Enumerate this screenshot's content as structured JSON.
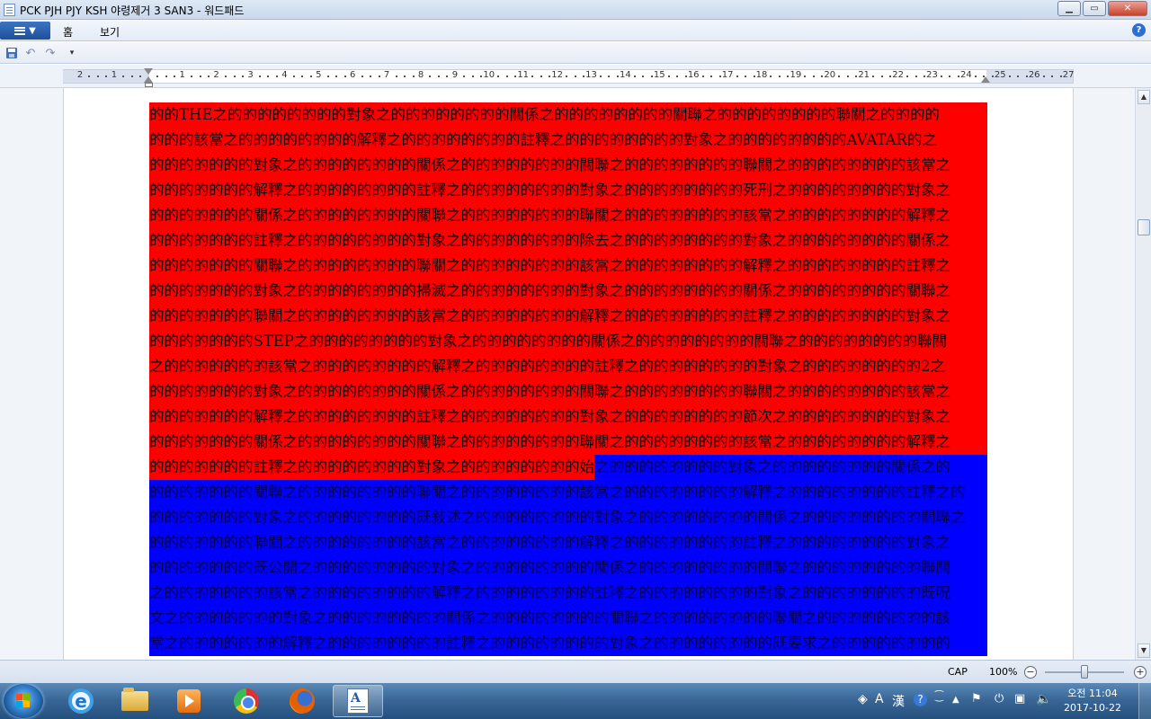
{
  "window": {
    "title": "PCK PJH PJY KSH 야령제거 3 SAN3 - 워드패드",
    "min_glyph": "▁",
    "max_glyph": "▭",
    "close_glyph": "✕"
  },
  "ribbon": {
    "tabs": [
      "홈",
      "보기"
    ],
    "help_glyph": "?"
  },
  "quick_access": {
    "undo_glyph": "↶",
    "redo_glyph": "↷",
    "dropdown_glyph": "▾"
  },
  "ruler": {
    "labels": [
      "2",
      "1",
      "",
      "1",
      "2",
      "3",
      "4",
      "5",
      "6",
      "7",
      "8",
      "9",
      "10",
      "11",
      "12",
      "13",
      "14",
      "15",
      "16",
      "17",
      "18",
      "19",
      "20",
      "21",
      "22",
      "23",
      "24",
      "25",
      "26",
      "27"
    ]
  },
  "document": {
    "lines": [
      [
        {
          "t": "的的THE之的的的的的的的的對象之的的的的的的的的關係之的的的的的的的的關聯之的的的的的的的的聯關之的的的的",
          "c": "red"
        }
      ],
      [
        {
          "t": "的的的該當之的的的的的的的的解釋之的的的的的的的的註釋之的的的的的的的的對象之的的的的的的的的AVATAR的之",
          "c": "red"
        }
      ],
      [
        {
          "t": "的的的的的的的對象之的的的的的的的的關係之的的的的的的的的關聯之的的的的的的的的聯關之的的的的的的的的該當之",
          "c": "red"
        }
      ],
      [
        {
          "t": "的的的的的的的解釋之的的的的的的的的註釋之的的的的的的的的對象之的的的的的的的的死刑之的的的的的的的的對象之",
          "c": "red"
        }
      ],
      [
        {
          "t": "的的的的的的的關係之的的的的的的的的關聯之的的的的的的的的聯關之的的的的的的的的該當之的的的的的的的的解釋之",
          "c": "red"
        }
      ],
      [
        {
          "t": "的的的的的的的註釋之的的的的的的的的對象之的的的的的的的的除去之的的的的的的的的對象之的的的的的的的的關係之",
          "c": "red"
        }
      ],
      [
        {
          "t": "的的的的的的的關聯之的的的的的的的的聯關之的的的的的的的的該當之的的的的的的的的解釋之的的的的的的的的註釋之",
          "c": "red"
        }
      ],
      [
        {
          "t": "的的的的的的的對象之的的的的的的的的掃滅之的的的的的的的的對象之的的的的的的的的關係之的的的的的的的的關聯之",
          "c": "red"
        }
      ],
      [
        {
          "t": "的的的的的的的聯關之的的的的的的的的該當之的的的的的的的的解釋之的的的的的的的的註釋之的的的的的的的的對象之",
          "c": "red"
        }
      ],
      [
        {
          "t": "的的的的的的的STEP之的的的的的的的的對象之的的的的的的的的關係之的的的的的的的的關聯之的的的的的的的的聯關",
          "c": "red"
        }
      ],
      [
        {
          "t": "之的的的的的的的該當之的的的的的的的的解釋之的的的的的的的的註釋之的的的的的的的的對象之的的的的的的的的2之",
          "c": "red"
        }
      ],
      [
        {
          "t": "的的的的的的的對象之的的的的的的的的關係之的的的的的的的的關聯之的的的的的的的的聯關之的的的的的的的的該當之",
          "c": "red"
        }
      ],
      [
        {
          "t": "的的的的的的的解釋之的的的的的的的的註釋之的的的的的的的的對象之的的的的的的的的節次之的的的的的的的的對象之",
          "c": "red"
        }
      ],
      [
        {
          "t": "的的的的的的的關係之的的的的的的的的關聯之的的的的的的的的聯關之的的的的的的的的該當之的的的的的的的的解釋之",
          "c": "red"
        }
      ],
      [
        {
          "t": "的的的的的的的註釋之的的的的的的的的對象之的的的的的的的的始",
          "c": "red"
        },
        {
          "t": "之的的的的的的的的對象之的的的的的的的的關係之的",
          "c": "blue"
        }
      ],
      [
        {
          "t": "的的的的的的的關聯之的的的的的的的的聯關之的的的的的的的的該當之的的的的的的的的解釋之的的的的的的的的註釋之的",
          "c": "blue"
        }
      ],
      [
        {
          "t": "的的的的的的的對象之的的的的的的的的既敍述之的的的的的的的的對象之的的的的的的的的關係之的的的的的的的的關聯之",
          "c": "blue"
        }
      ],
      [
        {
          "t": "的的的的的的的聯關之的的的的的的的的該當之的的的的的的的的解釋之的的的的的的的的註釋之的的的的的的的的對象之",
          "c": "blue"
        }
      ],
      [
        {
          "t": "的的的的的的的既公開之的的的的的的的的對象之的的的的的的的的關係之的的的的的的的的關聯之的的的的的的的的聯關",
          "c": "blue"
        }
      ],
      [
        {
          "t": "之的的的的的的的該當之的的的的的的的的解釋之的的的的的的的的註釋之的的的的的的的的對象之的的的的的的的的既呪",
          "c": "blue"
        }
      ],
      [
        {
          "t": "文之的的的的的的的對象之的的的的的的的的關係之的的的的的的的的關聯之的的的的的的的的聯關之的的的的的的的的該",
          "c": "blue"
        }
      ],
      [
        {
          "t": "當之的的的的的的的解釋之的的的的的的的的註釋之的的的的的的的的對象之的的的的的的的的既要求之的的的的的的的的",
          "c": "blue"
        }
      ]
    ]
  },
  "statusbar": {
    "caps": "CAP",
    "zoom": "100%",
    "zoom_level": 1.0,
    "minus_glyph": "−",
    "plus_glyph": "+"
  },
  "tray": {
    "ime_a": "A",
    "ime_han": "漢",
    "help_glyph": "?",
    "time": "오전 11:04",
    "date": "2017-10-22"
  }
}
